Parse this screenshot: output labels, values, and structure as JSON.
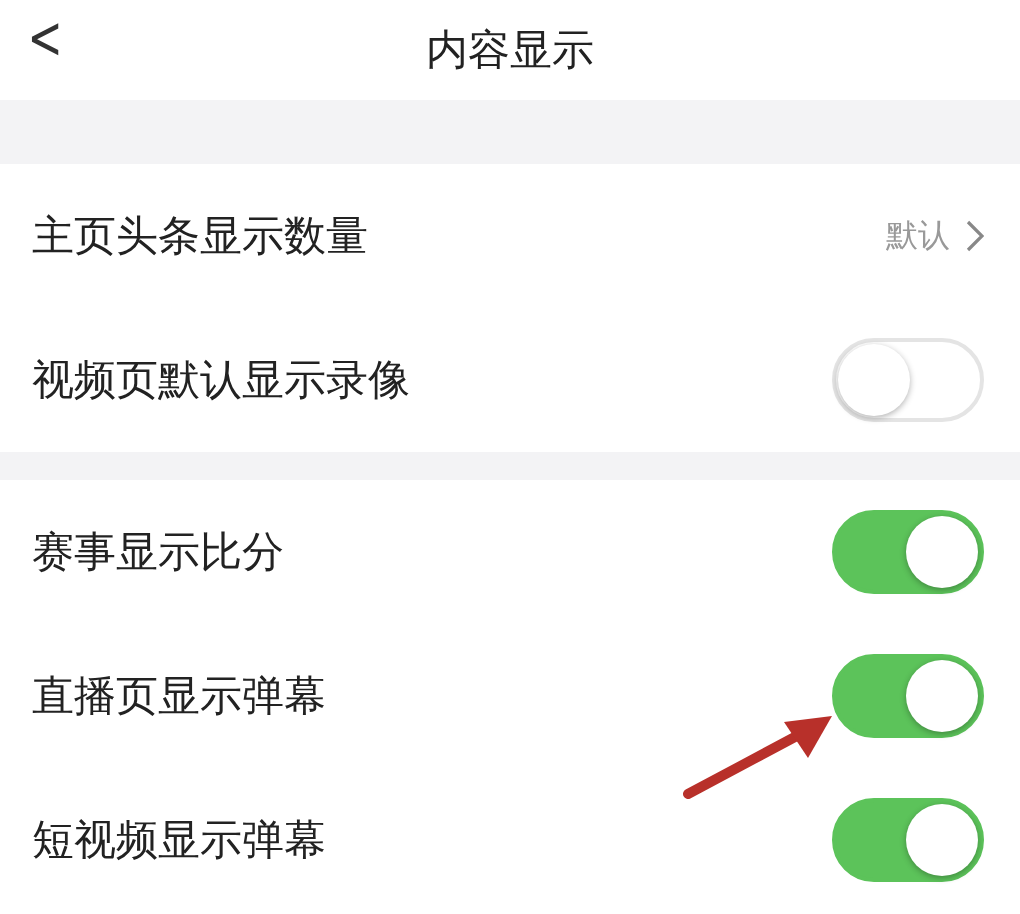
{
  "header": {
    "back": "<",
    "title": "内容显示"
  },
  "sections": [
    {
      "items": [
        {
          "kind": "link",
          "label": "主页头条显示数量",
          "value": "默认"
        },
        {
          "kind": "toggle",
          "label": "视频页默认显示录像",
          "on": false
        }
      ]
    },
    {
      "items": [
        {
          "kind": "toggle",
          "label": "赛事显示比分",
          "on": true
        },
        {
          "kind": "toggle",
          "label": "直播页显示弹幕",
          "on": true
        },
        {
          "kind": "toggle",
          "label": "短视频显示弹幕",
          "on": true
        }
      ]
    }
  ]
}
